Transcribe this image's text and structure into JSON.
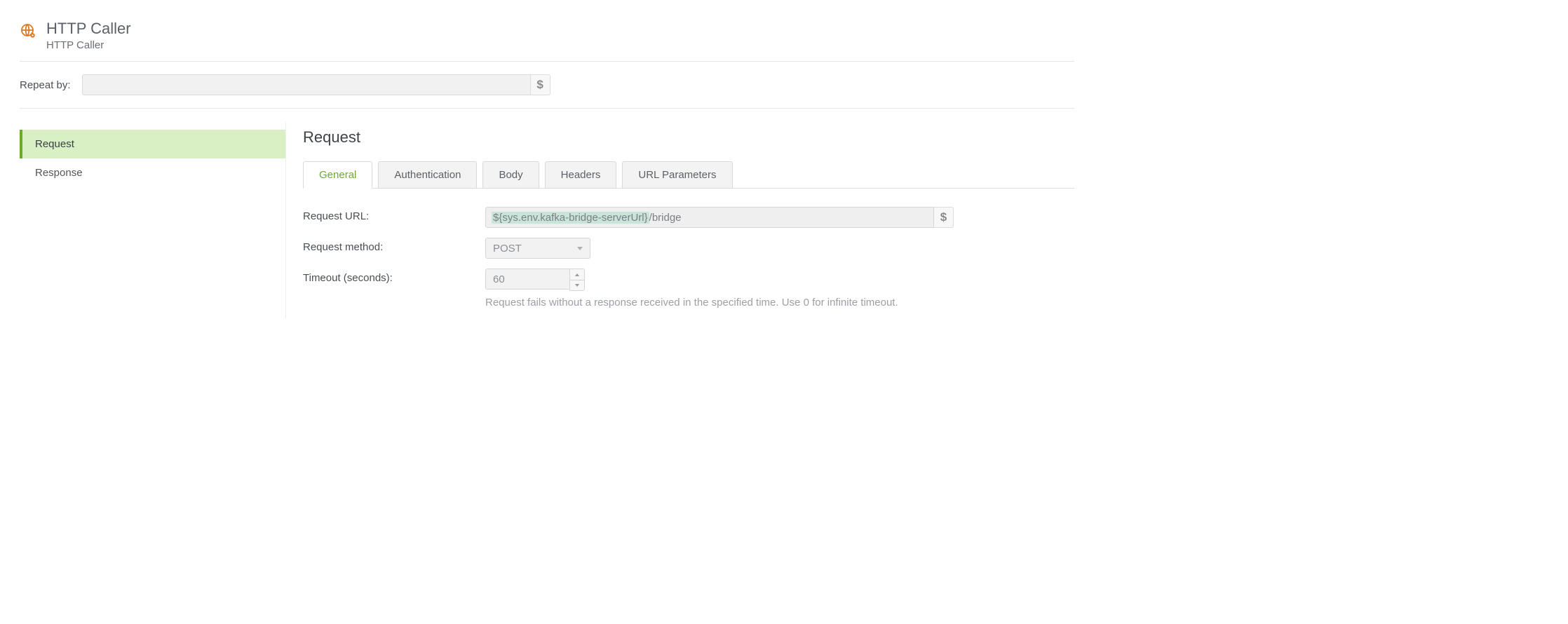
{
  "header": {
    "title": "HTTP Caller",
    "subtitle": "HTTP Caller",
    "icon_name": "globe-gear-icon"
  },
  "repeat": {
    "label": "Repeat by:",
    "value": ""
  },
  "side_nav": {
    "items": [
      {
        "label": "Request",
        "active": true
      },
      {
        "label": "Response",
        "active": false
      }
    ]
  },
  "main": {
    "heading": "Request",
    "tabs": [
      {
        "label": "General",
        "active": true
      },
      {
        "label": "Authentication",
        "active": false
      },
      {
        "label": "Body",
        "active": false
      },
      {
        "label": "Headers",
        "active": false
      },
      {
        "label": "URL Parameters",
        "active": false
      }
    ],
    "fields": {
      "request_url": {
        "label": "Request URL:",
        "var_part": "${sys.env.kafka-bridge-serverUrl}",
        "rest_part": "/bridge"
      },
      "request_method": {
        "label": "Request method:",
        "value": "POST"
      },
      "timeout": {
        "label": "Timeout (seconds):",
        "value": "60",
        "hint": "Request fails without a response received in the specified time. Use 0 for infinite timeout."
      }
    }
  },
  "glyphs": {
    "dollar": "$"
  }
}
